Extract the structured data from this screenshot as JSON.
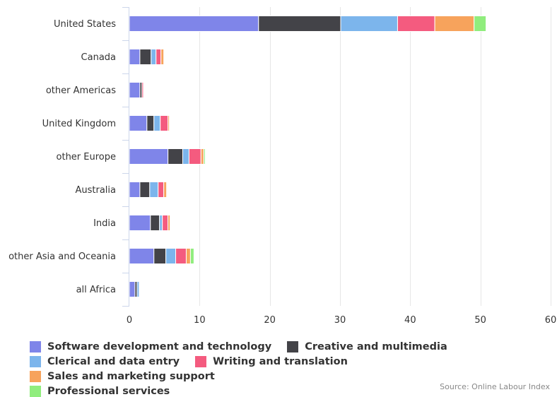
{
  "chart_data": {
    "type": "bar",
    "orientation": "horizontal",
    "stacked": true,
    "title": "",
    "xlabel": "",
    "ylabel": "",
    "xlim": [
      0,
      60
    ],
    "xticks": [
      0,
      10,
      20,
      30,
      40,
      50,
      60
    ],
    "grid": true,
    "legend_position": "bottom-left",
    "categories": [
      "United States",
      "Canada",
      "other Americas",
      "United Kingdom",
      "other Europe",
      "Australia",
      "India",
      "other Asia and Oceania",
      "all Africa"
    ],
    "series": [
      {
        "name": "Software development and technology",
        "color": "#7f85e9",
        "values": [
          18.4,
          1.5,
          1.5,
          2.5,
          5.5,
          1.5,
          3.0,
          3.5,
          0.8
        ]
      },
      {
        "name": "Creative and multimedia",
        "color": "#434348",
        "values": [
          11.7,
          1.6,
          0.3,
          1.0,
          2.1,
          1.4,
          1.3,
          1.7,
          0.3
        ]
      },
      {
        "name": "Clerical and data entry",
        "color": "#7cb5ec",
        "values": [
          8.1,
          0.7,
          0.0,
          0.9,
          0.9,
          1.2,
          0.4,
          1.4,
          0.3
        ]
      },
      {
        "name": "Writing and translation",
        "color": "#f45b7f",
        "values": [
          5.3,
          0.7,
          0.2,
          1.1,
          1.7,
          0.8,
          0.8,
          1.5,
          0.0
        ]
      },
      {
        "name": "Sales and marketing support",
        "color": "#f7a35c",
        "values": [
          5.6,
          0.4,
          0.0,
          0.2,
          0.4,
          0.4,
          0.3,
          0.6,
          0.0
        ]
      },
      {
        "name": "Professional services",
        "color": "#90ed7d",
        "values": [
          1.7,
          0.0,
          0.0,
          0.0,
          0.2,
          0.0,
          0.0,
          0.5,
          0.0
        ]
      }
    ],
    "source": "Source: Online Labour Index"
  }
}
